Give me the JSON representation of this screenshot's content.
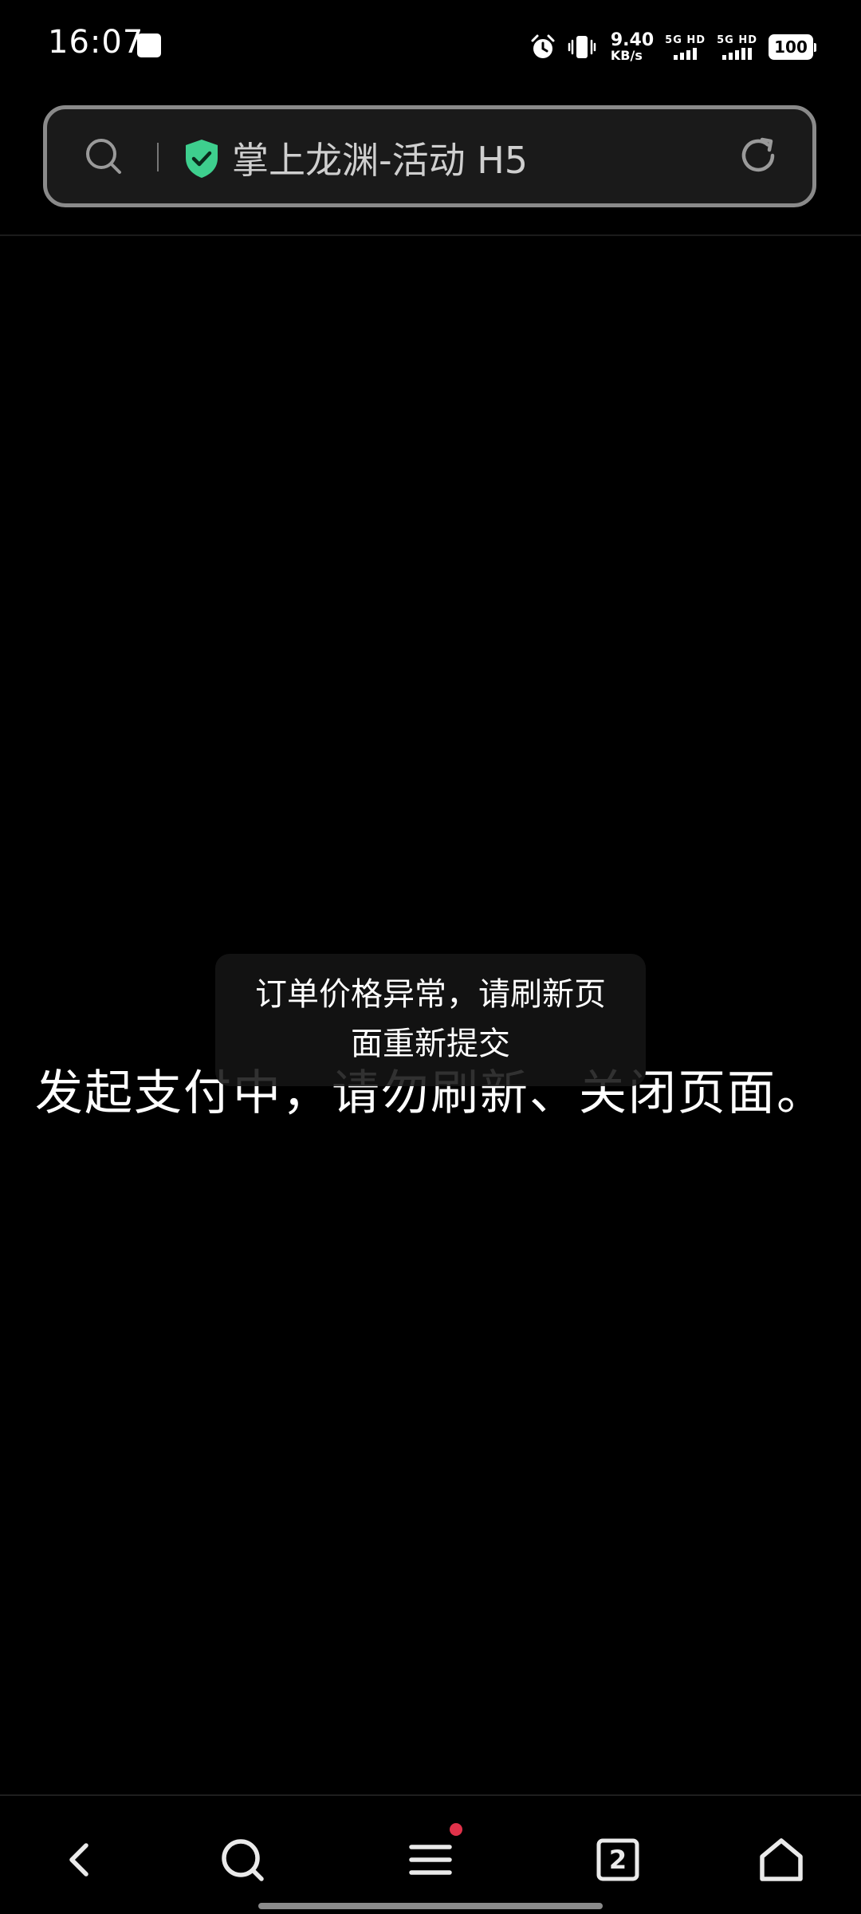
{
  "status_bar": {
    "time": "16:07",
    "net_speed_value": "9.40",
    "net_speed_unit": "KB/s",
    "sim1_label": "5G HD",
    "sim2_label": "5G HD",
    "battery": "100",
    "icons": [
      "app-notification-icon",
      "alarm-icon",
      "vibrate-icon",
      "signal-icon",
      "battery-icon"
    ]
  },
  "address_bar": {
    "title": "掌上龙渊-活动 H5",
    "secure_color": "#3ecf8e",
    "icons": [
      "search-icon",
      "shield-check-icon",
      "refresh-icon"
    ]
  },
  "main": {
    "payment_message": "发起支付中，请勿刷新、关闭页面。",
    "toast_line1": "订单价格异常，请刷新页",
    "toast_line2": "面重新提交"
  },
  "bottom_nav": {
    "items": [
      {
        "name": "back",
        "icon": "back-arrow-icon"
      },
      {
        "name": "search",
        "icon": "search-icon"
      },
      {
        "name": "menu",
        "icon": "menu-icon",
        "badge_color": "#e0324a"
      },
      {
        "name": "tabs",
        "icon": "tabs-icon",
        "count": "2"
      },
      {
        "name": "home",
        "icon": "home-icon"
      }
    ]
  }
}
